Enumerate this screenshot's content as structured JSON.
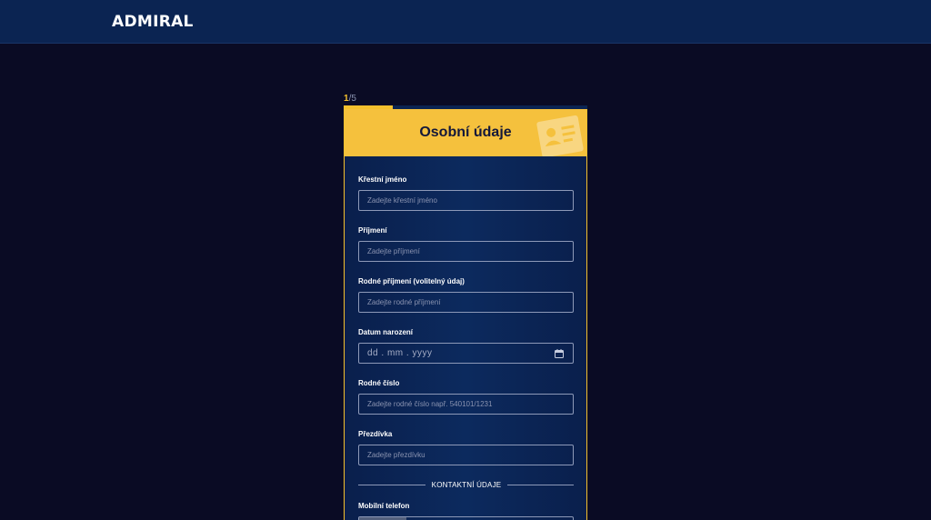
{
  "header": {
    "brand": "ADMIRAL"
  },
  "step": {
    "current": "1",
    "total": "/5",
    "progress_fraction": 0.2
  },
  "card": {
    "title": "Osobní údaje"
  },
  "fields": [
    {
      "label": "Křestní jméno",
      "placeholder": "Zadejte křestní jméno"
    },
    {
      "label": "Příjmení",
      "placeholder": "Zadejte příjmení"
    },
    {
      "label": "Rodné příjmení (volitelný údaj)",
      "placeholder": "Zadejte rodné příjmení"
    },
    {
      "label": "Datum narození",
      "placeholder": "dd . mm . yyyy"
    },
    {
      "label": "Rodné číslo",
      "placeholder": "Zadejte rodné číslo např. 540101/1231"
    },
    {
      "label": "Přezdívka",
      "placeholder": "Zadejte přezdívku"
    }
  ],
  "section": {
    "contact_heading": "KONTAKTNÍ ÚDAJE"
  },
  "contact": {
    "phone_label": "Mobilní telefon"
  },
  "colors": {
    "accent": "#f5c13d",
    "background": "#0a0b24",
    "topbar": "#0b2452",
    "card": "#0c2a5e"
  }
}
